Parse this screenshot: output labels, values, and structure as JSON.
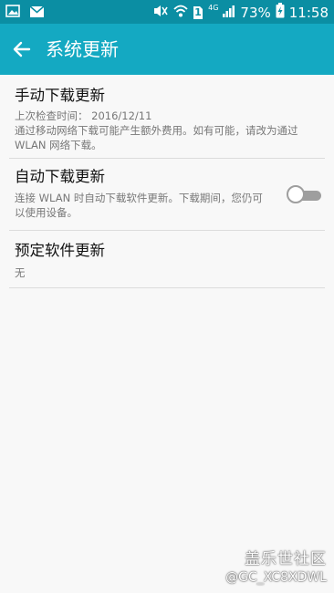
{
  "status_bar": {
    "battery": "73%",
    "time": "11:58",
    "network": "4G",
    "sim_slot": "1",
    "icons": [
      "gallery-icon",
      "mail-icon",
      "mute-icon",
      "wifi-icon",
      "sim-icon",
      "signal-icon",
      "battery-charging-icon"
    ]
  },
  "app_bar": {
    "title": "系统更新",
    "back_icon": "arrow-left-icon"
  },
  "items": [
    {
      "title": "手动下载更新",
      "last_check": "上次检查时间：  2016/12/11",
      "description": "通过移动网络下载可能产生额外费用。如有可能，请改为通过 WLAN 网络下载。"
    },
    {
      "title": "自动下载更新",
      "description": "连接 WLAN 时自动下载软件更新。下载期间，您仍可以使用设备。",
      "toggle_on": false
    },
    {
      "title": "预定软件更新",
      "value": "无"
    }
  ],
  "watermark": {
    "line1": "盖乐世社区",
    "line2": "@GC_XC8XDWL"
  },
  "colors": {
    "status_bar": "#0b8ea3",
    "app_bar": "#14a9c2",
    "background": "#f8f8f8"
  }
}
